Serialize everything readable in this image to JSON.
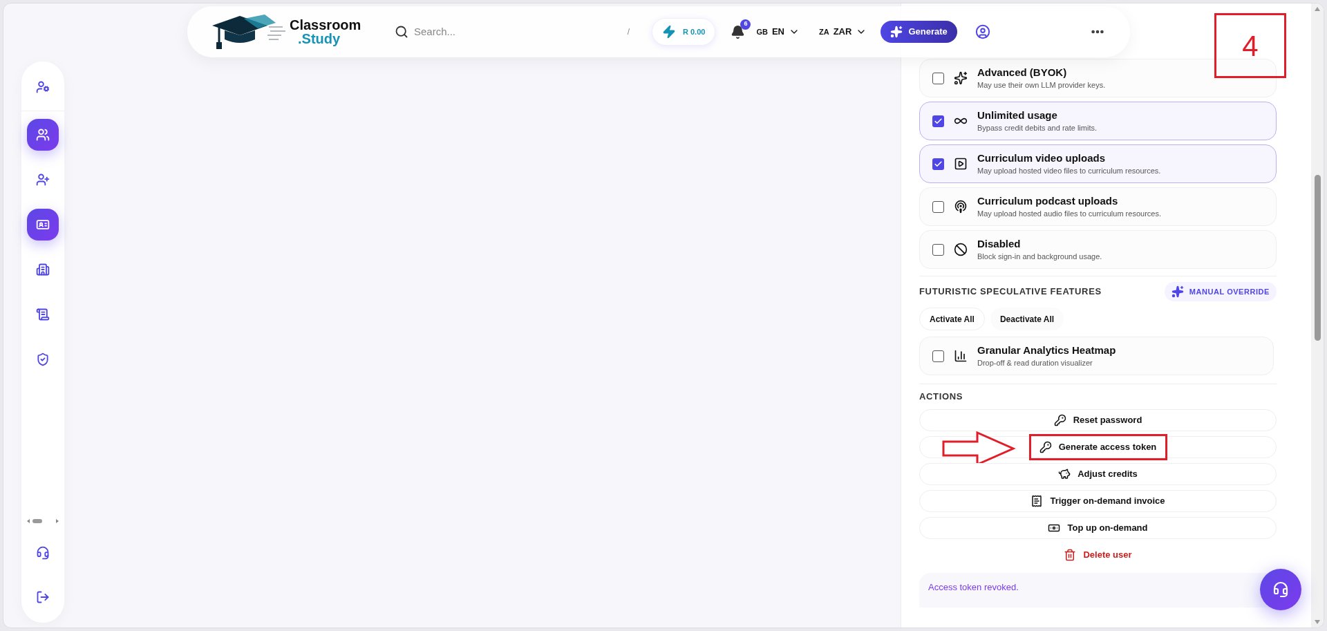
{
  "top_bar": {
    "logo": {
      "line1": "Classroom",
      "line2": ".Study"
    },
    "search": {
      "placeholder": "Search...",
      "shortcut": "/"
    },
    "credits": "R 0.00",
    "notifications": {
      "count": "6"
    },
    "language": {
      "flag": "GB",
      "code": "EN"
    },
    "currency": {
      "flag": "ZA",
      "code": "ZAR"
    },
    "generate_button": "Generate"
  },
  "sidebar": {
    "items": [
      {
        "kind": "user-settings",
        "selected": false
      },
      {
        "kind": "users",
        "selected": true
      },
      {
        "kind": "add-user",
        "selected": false
      },
      {
        "kind": "id-badge",
        "selected": true
      },
      {
        "kind": "building",
        "selected": false
      },
      {
        "kind": "document",
        "selected": false
      },
      {
        "kind": "shield-user",
        "selected": false
      }
    ],
    "bottom_items": [
      {
        "kind": "support",
        "selected": false
      },
      {
        "kind": "logout",
        "selected": false
      }
    ]
  },
  "panel": {
    "flags": {
      "items": [
        {
          "kind": "sparkles",
          "title": "Advanced (BYOK)",
          "description": "May use their own LLM provider keys.",
          "checked": false
        },
        {
          "kind": "infinity",
          "title": "Unlimited usage",
          "description": "Bypass credit debits and rate limits.",
          "checked": true
        },
        {
          "kind": "video",
          "title": "Curriculum video uploads",
          "description": "May upload hosted video files to curriculum resources.",
          "checked": true
        },
        {
          "kind": "podcast",
          "title": "Curriculum podcast uploads",
          "description": "May upload hosted audio files to curriculum resources.",
          "checked": false
        },
        {
          "kind": "ban",
          "title": "Disabled",
          "description": "Block sign-in and background usage.",
          "checked": false
        }
      ]
    },
    "features": {
      "title": "FUTURISTIC SPECULATIVE FEATURES",
      "override_button": "MANUAL OVERRIDE",
      "activate_all": "Activate All",
      "deactivate_all": "Deactivate All",
      "items": [
        {
          "kind": "chart",
          "title": "Granular Analytics Heatmap",
          "description": "Drop-off & read duration visualizer",
          "checked": false
        }
      ]
    },
    "actions": {
      "title": "ACTIONS",
      "items": [
        {
          "kind": "key",
          "label": "Reset password",
          "annotated": false
        },
        {
          "kind": "key",
          "label": "Generate access token",
          "annotated": true
        },
        {
          "kind": "piggy",
          "label": "Adjust credits",
          "annotated": false
        },
        {
          "kind": "receipt",
          "label": "Trigger on-demand invoice",
          "annotated": false
        },
        {
          "kind": "money",
          "label": "Top up on-demand",
          "annotated": false
        },
        {
          "kind": "delete",
          "label": "Delete user",
          "annotated": false
        }
      ]
    },
    "status_message": "Access token revoked."
  },
  "annotation": {
    "step_number": "4"
  }
}
